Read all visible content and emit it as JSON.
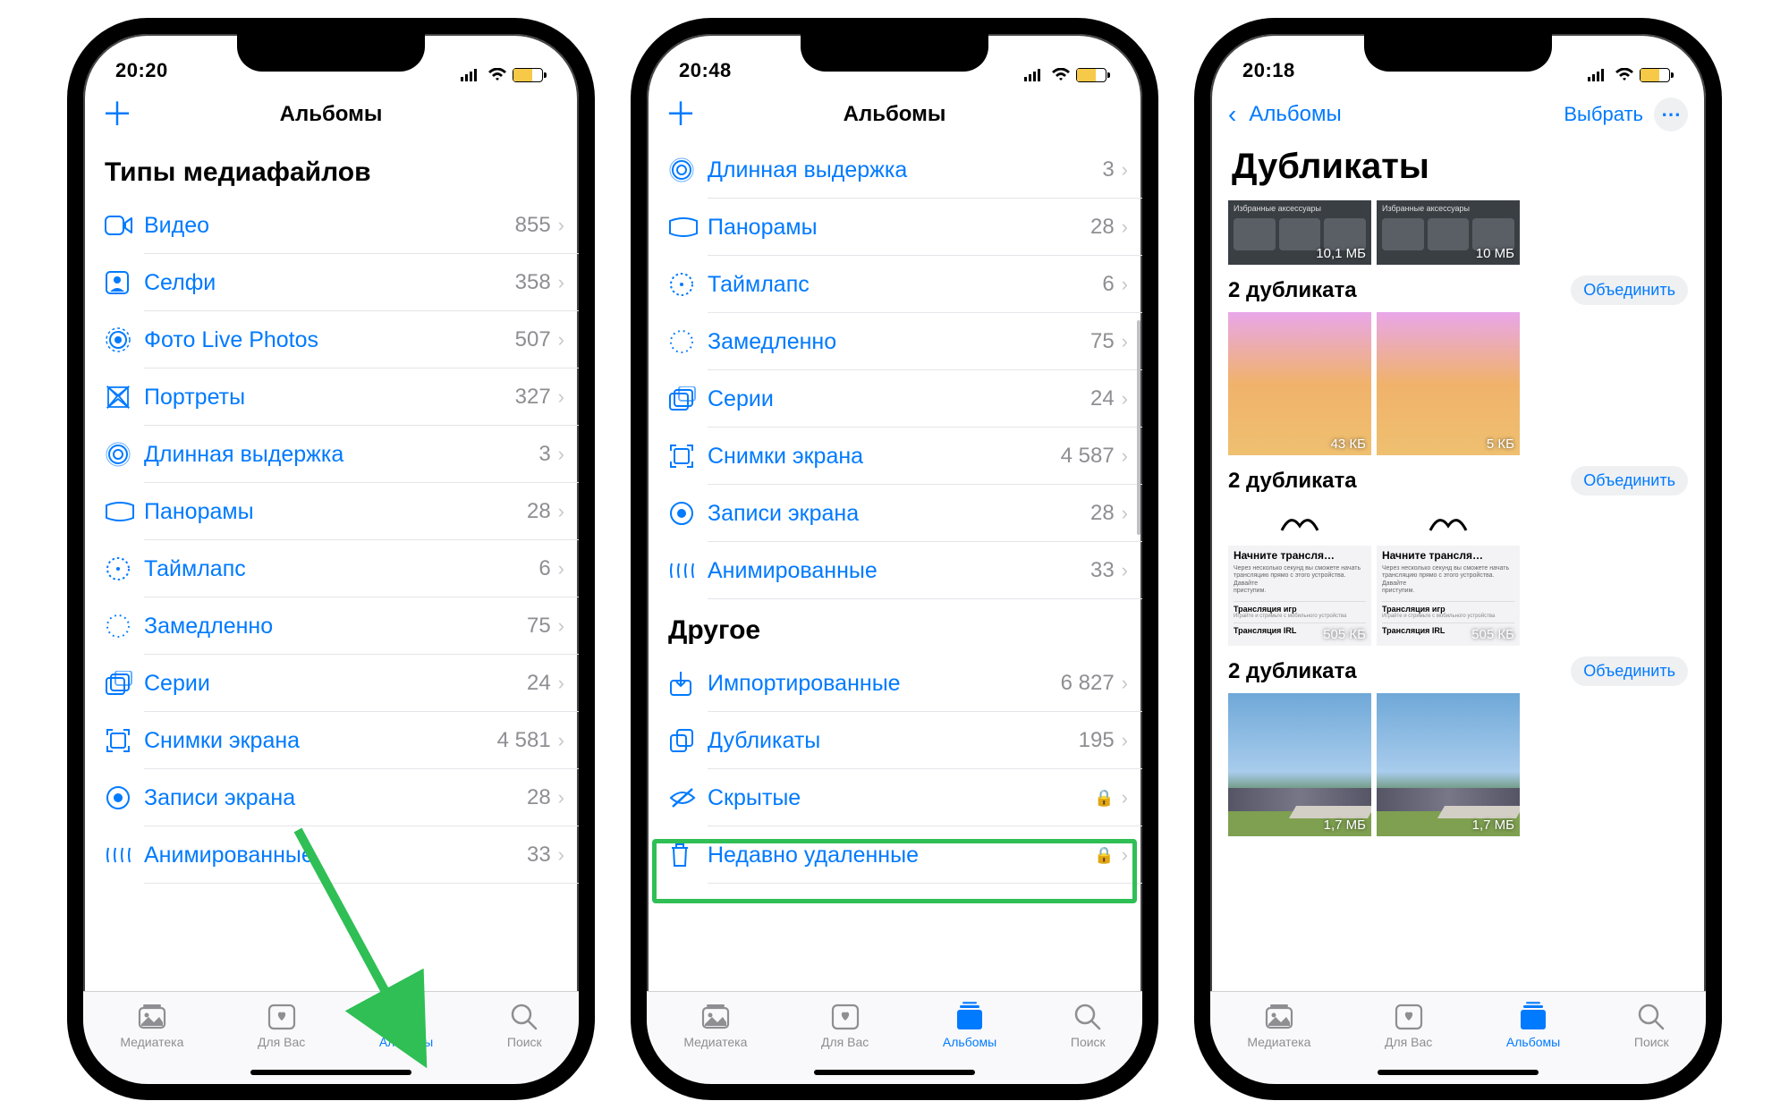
{
  "phone1": {
    "time": "20:20",
    "nav_title": "Альбомы",
    "section": "Типы медиафайлов",
    "rows": [
      {
        "label": "Видео",
        "count": "855"
      },
      {
        "label": "Селфи",
        "count": "358"
      },
      {
        "label": "Фото Live Photos",
        "count": "507"
      },
      {
        "label": "Портреты",
        "count": "327"
      },
      {
        "label": "Длинная выдержка",
        "count": "3"
      },
      {
        "label": "Панорамы",
        "count": "28"
      },
      {
        "label": "Таймлапс",
        "count": "6"
      },
      {
        "label": "Замедленно",
        "count": "75"
      },
      {
        "label": "Серии",
        "count": "24"
      },
      {
        "label": "Снимки экрана",
        "count": "4 581"
      },
      {
        "label": "Записи экрана",
        "count": "28"
      },
      {
        "label": "Анимированные",
        "count": "33"
      }
    ]
  },
  "phone2": {
    "time": "20:48",
    "nav_title": "Альбомы",
    "rowsA": [
      {
        "label": "Длинная выдержка",
        "count": "3"
      },
      {
        "label": "Панорамы",
        "count": "28"
      },
      {
        "label": "Таймлапс",
        "count": "6"
      },
      {
        "label": "Замедленно",
        "count": "75"
      },
      {
        "label": "Серии",
        "count": "24"
      },
      {
        "label": "Снимки экрана",
        "count": "4 587"
      },
      {
        "label": "Записи экрана",
        "count": "28"
      },
      {
        "label": "Анимированные",
        "count": "33"
      }
    ],
    "section_other": "Другое",
    "rowsB": [
      {
        "label": "Импортированные",
        "count": "6 827"
      },
      {
        "label": "Дубликаты",
        "count": "195"
      },
      {
        "label": "Скрытые",
        "lock": true
      },
      {
        "label": "Недавно удаленные",
        "lock": true
      }
    ]
  },
  "phone3": {
    "time": "20:18",
    "back_label": "Альбомы",
    "select": "Выбрать",
    "title": "Дубликаты",
    "merge": "Объединить",
    "top_badges": [
      "10,1 МБ",
      "10 МБ"
    ],
    "groups": [
      {
        "title": "2 дубликата",
        "badges": [
          "43 КБ",
          "5 КБ"
        ],
        "type": "gradient"
      },
      {
        "title": "2 дубликата",
        "badges": [
          "505 КБ",
          "505 КБ"
        ],
        "type": "tech",
        "tech_title": "Начните трансля…",
        "tech_l1": "Через несколько секунд вы сможете начать",
        "tech_l2": "трансляцию прямо с этого устройства. Давайте",
        "tech_l3": "приступим.",
        "tech_b1": "Трансляция игр",
        "tech_b1s": "Играйте и стримьте с мобильного устройства",
        "tech_b2": "Трансляция IRL"
      },
      {
        "title": "2 дубликата",
        "badges": [
          "1,7 МБ",
          "1,7 МБ"
        ],
        "type": "sky"
      }
    ]
  },
  "tabs": {
    "t1": "Медиатека",
    "t2": "Для Вас",
    "t3": "Альбомы",
    "t4": "Поиск"
  }
}
